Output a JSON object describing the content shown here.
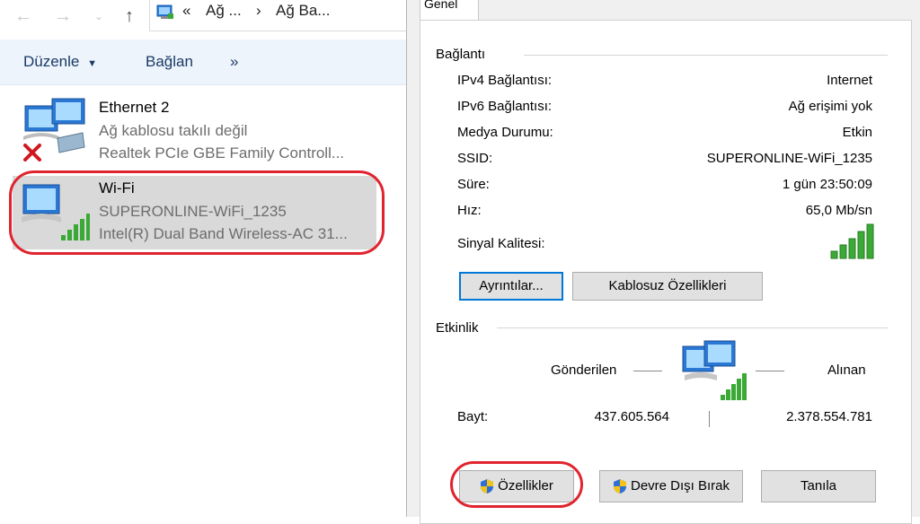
{
  "explorer": {
    "address": {
      "overflow": "«",
      "crumb1": "Ağ ...",
      "sep": "›",
      "crumb2": "Ağ Ba..."
    },
    "toolbar": {
      "organize_label": "Düzenle",
      "connect_label": "Bağlan",
      "more_label": "»"
    },
    "connections": [
      {
        "name": "Ethernet 2",
        "status": "Ağ kablosu takılı değil",
        "device": "Realtek PCIe GBE Family Controll..."
      },
      {
        "name": "Wi-Fi",
        "status": "SUPERONLINE-WiFi_1235",
        "device": "Intel(R) Dual Band Wireless-AC 31..."
      }
    ]
  },
  "dialog": {
    "tab_general": "Genel",
    "connection": {
      "heading": "Bağlantı",
      "rows": [
        {
          "label": "IPv4 Bağlantısı:",
          "value": "Internet"
        },
        {
          "label": "IPv6 Bağlantısı:",
          "value": "Ağ erişimi yok"
        },
        {
          "label": "Medya Durumu:",
          "value": "Etkin"
        },
        {
          "label": "SSID:",
          "value": "SUPERONLINE-WiFi_1235"
        },
        {
          "label": "Süre:",
          "value": "1 gün 23:50:09"
        },
        {
          "label": "Hız:",
          "value": "65,0 Mb/sn"
        }
      ],
      "signal_label": "Sinyal Kalitesi:",
      "signal_bars": 5,
      "details_button": "Ayrıntılar...",
      "wireless_props_button": "Kablosuz Özellikleri"
    },
    "activity": {
      "heading": "Etkinlik",
      "sent_label": "Gönderilen",
      "received_label": "Alınan",
      "bytes_label": "Bayt:",
      "bytes_sent": "437.605.564",
      "bytes_received": "2.378.554.781"
    },
    "buttons": {
      "properties": "Özellikler",
      "disable": "Devre Dışı Bırak",
      "diagnose": "Tanıla"
    }
  },
  "colors": {
    "highlight_ring": "#e0242f",
    "signal_green": "#3aa935",
    "focus_blue": "#0078d7"
  }
}
